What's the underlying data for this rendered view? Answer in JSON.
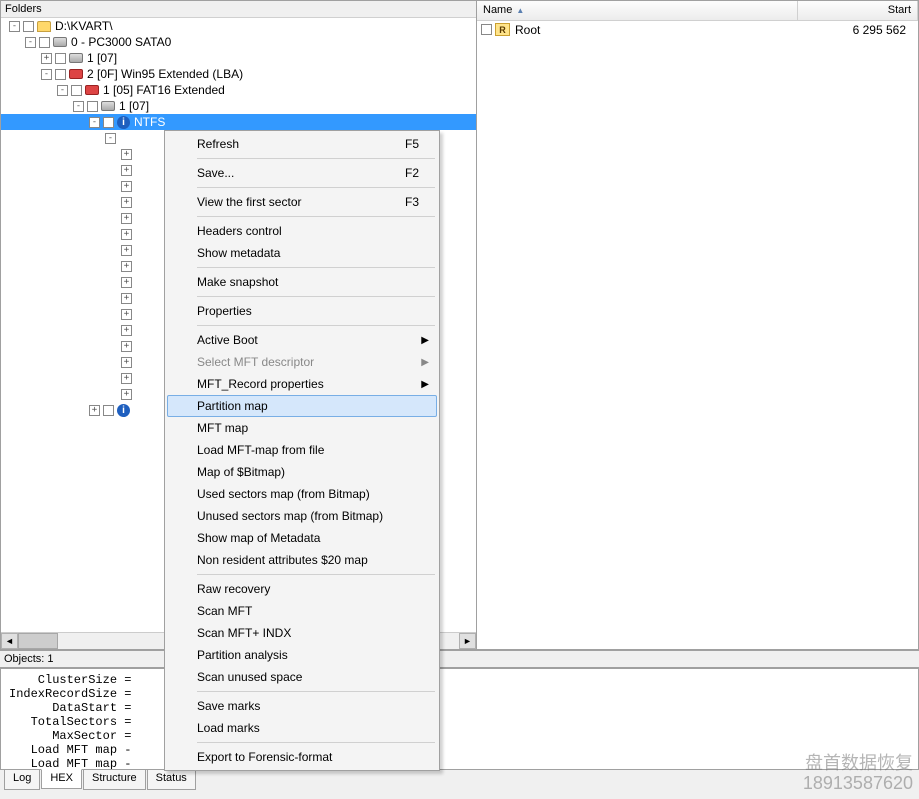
{
  "left": {
    "header": "Folders",
    "tree": [
      {
        "indent": 0,
        "exp": "-",
        "cb": true,
        "icon": "folder-icon",
        "label": "D:\\KVART\\"
      },
      {
        "indent": 1,
        "exp": "-",
        "cb": true,
        "icon": "drive-icon",
        "label": "0 - PC3000 SATA0"
      },
      {
        "indent": 2,
        "exp": "+",
        "cb": true,
        "icon": "drive-icon",
        "label": "1 [07]"
      },
      {
        "indent": 2,
        "exp": "-",
        "cb": true,
        "icon": "red-icon",
        "label": "2 [0F] Win95 Extended  (LBA)"
      },
      {
        "indent": 3,
        "exp": "-",
        "cb": true,
        "icon": "red-icon",
        "label": "1 [05] FAT16 Extended"
      },
      {
        "indent": 4,
        "exp": "-",
        "cb": true,
        "icon": "drive-icon",
        "label": "1 [07]"
      },
      {
        "indent": 5,
        "exp": "-",
        "cb": true,
        "icon": "info-icon",
        "label": "NTFS",
        "selected": true
      },
      {
        "indent": 6,
        "exp": "-",
        "label": ""
      },
      {
        "indent": 7,
        "exp": "+",
        "label": ""
      },
      {
        "indent": 7,
        "exp": "+",
        "label": ""
      },
      {
        "indent": 7,
        "exp": "+",
        "label": ""
      },
      {
        "indent": 7,
        "exp": "+",
        "label": ""
      },
      {
        "indent": 7,
        "exp": "+",
        "label": ""
      },
      {
        "indent": 7,
        "exp": "+",
        "label": ""
      },
      {
        "indent": 7,
        "exp": "+",
        "label": ""
      },
      {
        "indent": 7,
        "exp": "+",
        "label": ""
      },
      {
        "indent": 7,
        "exp": "+",
        "label": ""
      },
      {
        "indent": 7,
        "exp": "+",
        "label": ""
      },
      {
        "indent": 7,
        "exp": "+",
        "label": ""
      },
      {
        "indent": 7,
        "exp": "+",
        "label": ""
      },
      {
        "indent": 7,
        "exp": "+",
        "label": ""
      },
      {
        "indent": 7,
        "exp": "+",
        "label": ""
      },
      {
        "indent": 7,
        "exp": "+",
        "label": ""
      },
      {
        "indent": 7,
        "exp": "+",
        "label": ""
      },
      {
        "indent": 5,
        "exp": "+",
        "cb": true,
        "icon": "info-icon",
        "label": ""
      }
    ]
  },
  "right": {
    "col_name": "Name",
    "col_start": "Start",
    "rows": [
      {
        "name": "Root",
        "start": "6 295 562"
      }
    ]
  },
  "objects_bar": "Objects: 1",
  "info_lines": [
    "    ClusterSize =",
    "IndexRecordSize =",
    "      DataStart =",
    "   TotalSectors =",
    "      MaxSector =",
    "   Load MFT map -",
    "   Load MFT map -"
  ],
  "tabs": [
    "Log",
    "HEX",
    "Structure",
    "Status"
  ],
  "active_tab": 1,
  "menu": {
    "items": [
      {
        "label": "Refresh",
        "shortcut": "F5"
      },
      {
        "sep": true
      },
      {
        "label": "Save...",
        "shortcut": "F2"
      },
      {
        "sep": true
      },
      {
        "label": "View the first sector",
        "shortcut": "F3"
      },
      {
        "sep": true
      },
      {
        "label": "Headers control"
      },
      {
        "label": "Show metadata"
      },
      {
        "sep": true
      },
      {
        "label": "Make snapshot"
      },
      {
        "sep": true
      },
      {
        "label": "Properties"
      },
      {
        "sep": true
      },
      {
        "label": "Active Boot",
        "submenu": true
      },
      {
        "label": "Select MFT descriptor",
        "submenu": true,
        "disabled": true
      },
      {
        "label": "MFT_Record properties",
        "submenu": true
      },
      {
        "label": "Partition map",
        "hover": true
      },
      {
        "label": "MFT map"
      },
      {
        "label": "Load MFT-map from file"
      },
      {
        "label": "Map of $Bitmap)"
      },
      {
        "label": "Used sectors map (from Bitmap)"
      },
      {
        "label": "Unused sectors map (from Bitmap)"
      },
      {
        "label": "Show map of Metadata"
      },
      {
        "label": "Non resident attributes $20 map"
      },
      {
        "sep": true
      },
      {
        "label": "Raw recovery"
      },
      {
        "label": "Scan MFT"
      },
      {
        "label": "Scan MFT+ INDX"
      },
      {
        "label": "Partition analysis"
      },
      {
        "label": "Scan unused space"
      },
      {
        "sep": true
      },
      {
        "label": "Save marks"
      },
      {
        "label": "Load marks"
      },
      {
        "sep": true
      },
      {
        "label": "Export to Forensic-format"
      }
    ]
  },
  "watermark": {
    "line1": "盘首数据恢复",
    "line2": "18913587620"
  }
}
